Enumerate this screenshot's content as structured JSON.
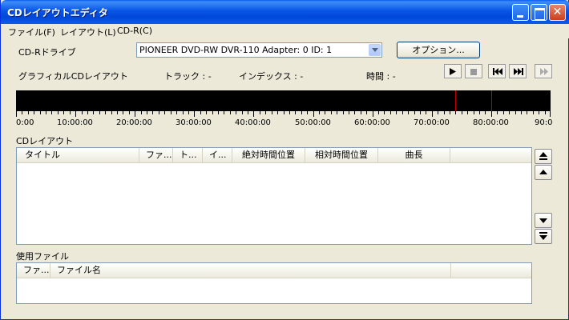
{
  "window": {
    "title": "CDレイアウトエディタ"
  },
  "menu": [
    "ファイル(F)",
    "レイアウト(L)",
    "CD-R(C)"
  ],
  "drive": {
    "label": "CD-Rドライブ",
    "selected": "PIONEER DVD-RW  DVR-110    Adapter: 0  ID: 1",
    "options_button": "オプション..."
  },
  "info": {
    "graphical_label": "グラフィカルCDレイアウト",
    "track": "トラック : -",
    "index": "インデックス : -",
    "time": "時間 : -"
  },
  "transport": [
    "play-icon",
    "stop-icon",
    "skip-back-icon",
    "skip-forward-icon",
    "fast-forward-icon"
  ],
  "timeline": {
    "ticks": [
      "0:00",
      "10:00:00",
      "20:00:00",
      "30:00:00",
      "40:00:00",
      "50:00:00",
      "60:00:00",
      "70:00:00",
      "80:00:00",
      "90:0"
    ],
    "markers_minutes": [
      74,
      80
    ]
  },
  "cd_layout": {
    "label": "CDレイアウト",
    "columns": [
      "タイトル",
      "ファ...",
      "ト...",
      "イ...",
      "絶対時間位置",
      "相対時間位置",
      "曲長"
    ],
    "rows": []
  },
  "used_files": {
    "label": "使用ファイル",
    "columns": [
      "ファ...",
      "ファイル名"
    ],
    "rows": []
  },
  "colors": {
    "titlebar": "#0054e3",
    "timeline_bg": "#000000",
    "marker": "#c00000"
  }
}
